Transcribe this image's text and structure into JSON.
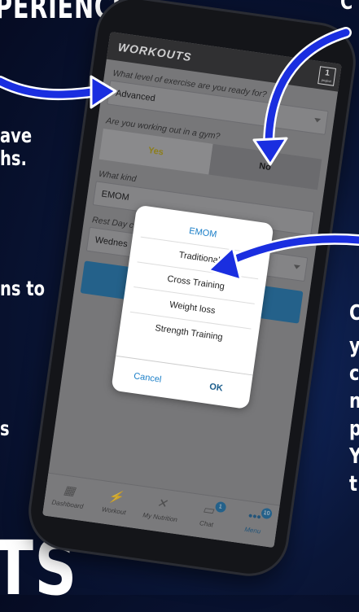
{
  "promo": {
    "title": "PERIENCE",
    "left_fragments": [
      "ave",
      "hs.",
      "ns to",
      "s"
    ],
    "right_fragments": [
      "C",
      "y",
      "c",
      "n",
      "p",
      "Y",
      "t"
    ],
    "big_text": "TS",
    "top_right_fragment": "C"
  },
  "app": {
    "title": "WORKOUTS",
    "logo_number": "1",
    "logo_sub": "project",
    "q_level": "What level of exercise are you ready for?",
    "level_value": "Advanced",
    "q_gym": "Are you working out in a gym?",
    "gym_yes": "Yes",
    "gym_no": "No",
    "q_kind": "What kind",
    "kind_value": "EMOM",
    "q_rest": "Rest Day c",
    "rest_value": "Wednes"
  },
  "picker": {
    "options": [
      "EMOM",
      "Traditional",
      "Cross Training",
      "Weight loss",
      "Strength Training"
    ],
    "selected": "EMOM",
    "cancel": "Cancel",
    "ok": "OK"
  },
  "tabbar": {
    "items": [
      {
        "label": "Dashboard",
        "icon": "grid-icon"
      },
      {
        "label": "Workout",
        "icon": "runner-icon"
      },
      {
        "label": "My Nutrition",
        "icon": "utensils-icon"
      },
      {
        "label": "Chat",
        "icon": "chat-icon",
        "badge": "1"
      },
      {
        "label": "Menu",
        "icon": "more-icon",
        "badge": "10"
      }
    ],
    "active": "Menu"
  },
  "colors": {
    "accent": "#1d6ea3",
    "arrow": "#1a2ee0",
    "background": "#0a1638"
  }
}
